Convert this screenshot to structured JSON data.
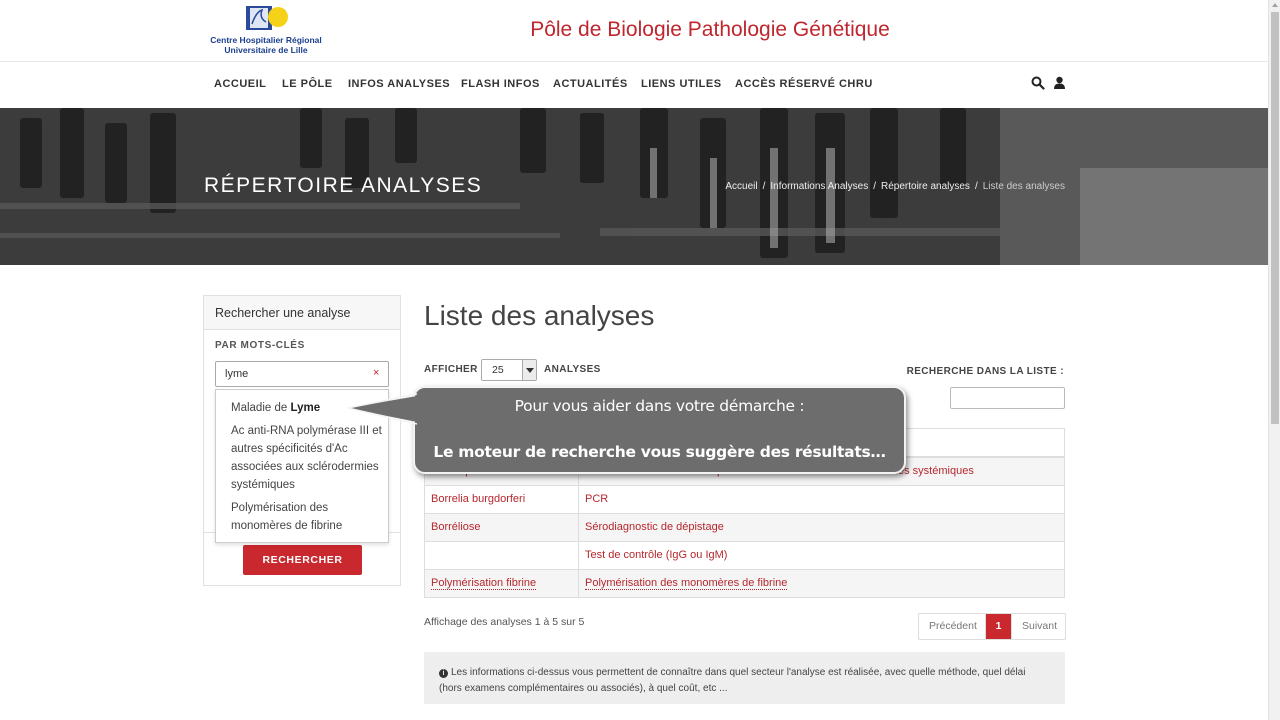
{
  "header": {
    "logo_line1": "Centre Hospitalier Régional",
    "logo_line2": "Universitaire de Lille",
    "site_title": "Pôle de Biologie Pathologie Génétique"
  },
  "nav": {
    "items": [
      "ACCUEIL",
      "LE PÔLE",
      "INFOS ANALYSES",
      "FLASH INFOS",
      "ACTUALITÉS",
      "LIENS UTILES",
      "ACCÈS RÉSERVÉ CHRU"
    ]
  },
  "hero": {
    "title": "RÉPERTOIRE ANALYSES",
    "breadcrumb": [
      "Accueil",
      "Informations Analyses",
      "Répertoire analyses",
      "Liste des analyses"
    ],
    "separator": "/"
  },
  "sidebar": {
    "heading": "Rechercher une analyse",
    "keywords_label": "PAR MOTS-CLÉS",
    "keywords_value": "lyme",
    "clear_symbol": "×",
    "search_button": "RECHERCHER",
    "suggestions": [
      {
        "before": "Maladie de ",
        "bold": "Lyme",
        "after": ""
      },
      {
        "before": "Ac anti-RNA polymérase III et autres spécificités d'Ac associées aux sclérodermies systémiques",
        "bold": "",
        "after": ""
      },
      {
        "before": "Polymérisation des monomères de fibrine",
        "bold": "",
        "after": ""
      }
    ]
  },
  "main": {
    "title": "Liste des analyses",
    "show_label": "AFFICHER",
    "show_value": "25",
    "show_suffix": "ANALYSES",
    "filter_label": "RECHERCHE DANS LA LISTE :",
    "rows": [
      {
        "c1": "Anticorps anti-nucléaire",
        "c2": "Ac anti-RNA-Po et autres spécificités associées aux sclérodermies systémiques"
      },
      {
        "c1": "Borrelia burgdorferi",
        "c2": "PCR"
      },
      {
        "c1": "Borréliose",
        "c2": "Sérodiagnostic de dépistage"
      },
      {
        "c1": "",
        "c2": "Test de contrôle (IgG ou IgM)"
      },
      {
        "c1": "Polymérisation fibrine",
        "c2": "Polymérisation des monomères de fibrine"
      }
    ],
    "table_info": "Affichage des analyses 1 à 5 sur 5",
    "pager": {
      "prev": "Précédent",
      "current": "1",
      "next": "Suivant"
    },
    "info_text": "Les informations ci-dessus vous permettent de connaître dans quel secteur l'analyse est réalisée, avec quelle méthode, quel délai (hors examens complémentaires ou associés), à quel coût, etc ..."
  },
  "callout": {
    "line1": "Pour vous aider dans votre démarche :",
    "line2": "Le moteur de recherche vous suggère des résultats…"
  },
  "colors": {
    "brand_red": "#c9282e",
    "link_red": "#b5272d",
    "logo_blue": "#1b3f8f",
    "callout_gray": "#6d6d6d"
  }
}
